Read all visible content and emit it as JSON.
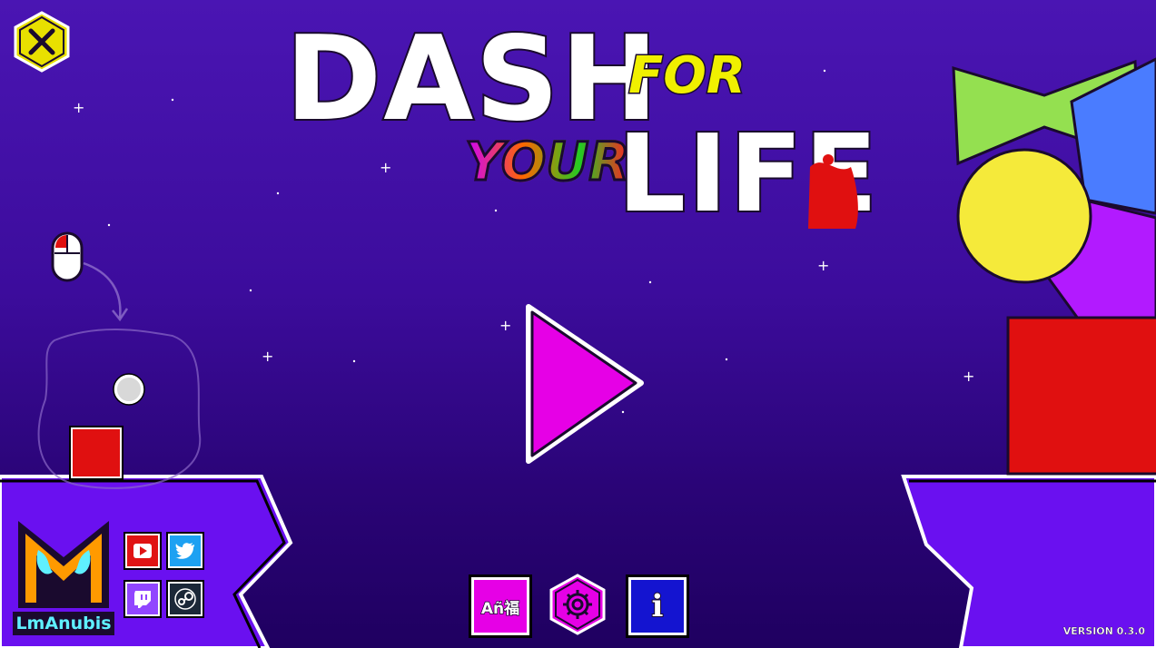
{
  "title": {
    "word_dash": "DASH",
    "word_for": "FOR",
    "word_your": "YOUR",
    "word_life": "LIFE"
  },
  "tutorial": {
    "mouse_icon": "mouse-left-click-icon"
  },
  "branding": {
    "studio_name": "LmAnubis"
  },
  "social": [
    {
      "name": "youtube-icon",
      "color": "#e01414"
    },
    {
      "name": "twitter-icon",
      "color": "#1da1f2"
    },
    {
      "name": "twitch-icon",
      "color": "#9146ff"
    },
    {
      "name": "steam-icon",
      "color": "#1b2838"
    }
  ],
  "menu": {
    "language_label": "Añ福",
    "settings_icon": "gear-icon",
    "info_label": "i"
  },
  "version": "VERSION 0.3.0",
  "colors": {
    "play": "#e600e6",
    "player_cube": "#e01010",
    "ground": "#6a10f0",
    "close": "#e8e000"
  }
}
